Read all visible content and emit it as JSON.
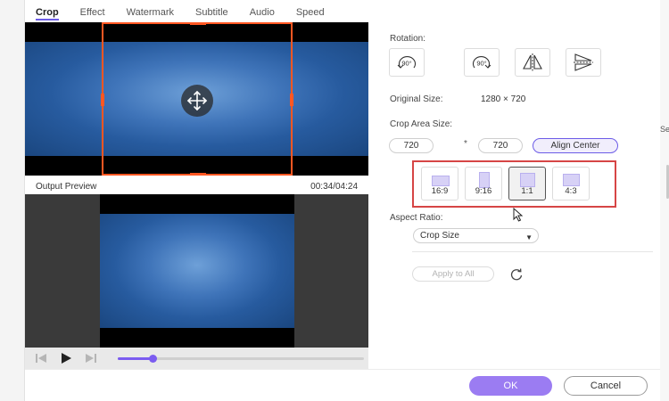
{
  "tabs": [
    {
      "label": "Crop",
      "active": true
    },
    {
      "label": "Effect",
      "active": false
    },
    {
      "label": "Watermark",
      "active": false
    },
    {
      "label": "Subtitle",
      "active": false
    },
    {
      "label": "Audio",
      "active": false
    },
    {
      "label": "Speed",
      "active": false
    }
  ],
  "preview": {
    "output_label": "Output Preview",
    "timecode": "00:34/04:24",
    "progress_fraction": 0.14
  },
  "rotation": {
    "label": "Rotation:",
    "buttons": [
      {
        "icon": "rotate-left-90-icon",
        "text": "90°"
      },
      {
        "icon": "rotate-right-90-icon",
        "text": "90°"
      },
      {
        "icon": "flip-horizontal-icon"
      },
      {
        "icon": "flip-vertical-icon"
      }
    ]
  },
  "original_size": {
    "label": "Original Size:",
    "value": "1280 × 720"
  },
  "crop_area": {
    "label": "Crop Area Size:",
    "width": "720",
    "height": "720",
    "separator": "*",
    "align_label": "Align Center"
  },
  "ratios": [
    {
      "label": "16:9",
      "selected": false
    },
    {
      "label": "9:16",
      "selected": false
    },
    {
      "label": "1:1",
      "selected": true
    },
    {
      "label": "4:3",
      "selected": false
    }
  ],
  "aspect_ratio": {
    "label": "Aspect Ratio:",
    "selected": "Crop Size"
  },
  "apply_all_label": "Apply to All",
  "footer": {
    "ok_label": "OK",
    "cancel_label": "Cancel"
  },
  "edge_text": "Se",
  "colors": {
    "accent": "#7b5cf0",
    "crop_border": "#ff5722",
    "highlight_box": "#d64545"
  }
}
